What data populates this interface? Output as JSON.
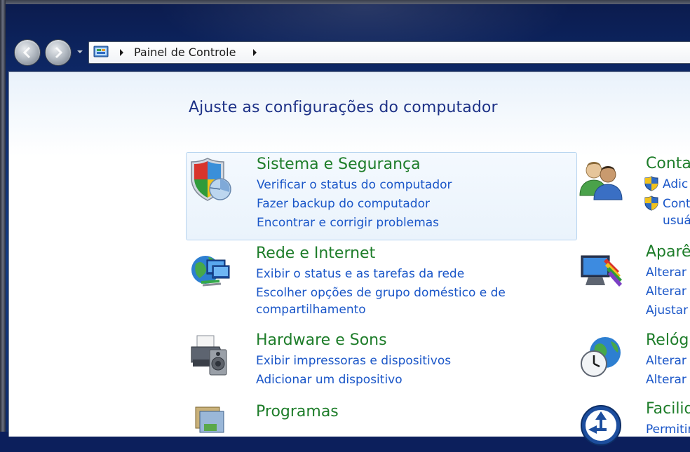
{
  "nav": {
    "breadcrumb": "Painel de Controle"
  },
  "page": {
    "title": "Ajuste as configurações do computador"
  },
  "categories_left": [
    {
      "title": "Sistema e Segurança",
      "links": [
        "Verificar o status do computador",
        "Fazer backup do computador",
        "Encontrar e corrigir problemas"
      ]
    },
    {
      "title": "Rede e Internet",
      "links": [
        "Exibir o status e as tarefas da rede",
        "Escolher opções de grupo doméstico e de",
        "compartilhamento"
      ]
    },
    {
      "title": "Hardware e Sons",
      "links": [
        "Exibir impressoras e dispositivos",
        "Adicionar um dispositivo"
      ]
    },
    {
      "title": "Programas",
      "links": []
    }
  ],
  "categories_right": [
    {
      "title": "Conta",
      "links": [
        "Adic",
        "Cont",
        "usuá"
      ]
    },
    {
      "title": "Aparê",
      "links": [
        "Alterar o",
        "Alterar p",
        "Ajustar"
      ]
    },
    {
      "title": "Relóg",
      "links": [
        "Alterar d",
        "Alterar i"
      ]
    },
    {
      "title": "Facilid",
      "links": [
        "Permitir"
      ]
    }
  ],
  "colors": {
    "category_title": "#1e7d2a",
    "link": "#1a56c8",
    "page_title": "#1e3287"
  }
}
